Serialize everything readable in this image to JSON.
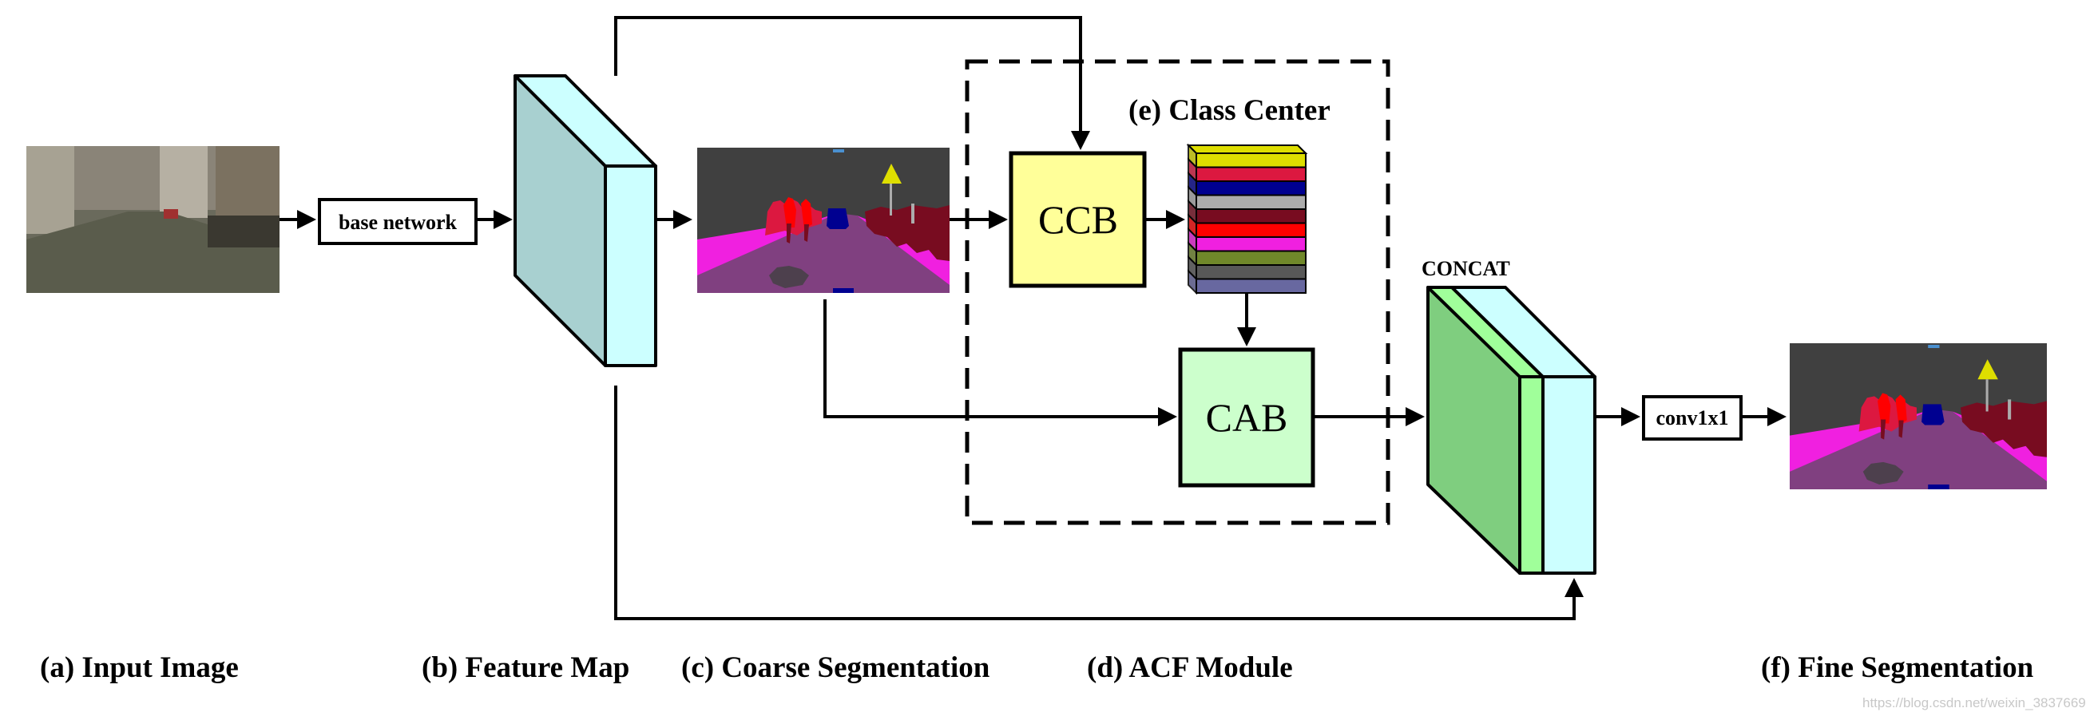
{
  "blocks": {
    "base_network": "base network",
    "ccb": "CCB",
    "cab": "CAB",
    "concat": "CONCAT",
    "conv": "conv1x1",
    "class_center": "(e) Class Center"
  },
  "captions": {
    "a": "(a) Input Image",
    "b": "(b) Feature Map",
    "c": "(c) Coarse Segmentation",
    "d": "(d) ACF Module",
    "f": "(f) Fine Segmentation"
  },
  "watermark": "https://blog.csdn.net/weixin_38376693",
  "colors": {
    "ccb_fill": "#ffff99",
    "cab_fill": "#ccffcc",
    "feature_front": "#ccffff",
    "feature_side": "#a8d0d0",
    "concat_green": "#7fce7f",
    "concat_light_green": "#a0ff9a",
    "class_center_bands": [
      "#dede00",
      "#dc1840",
      "#000090",
      "#acacac",
      "#780c20",
      "#ff0000",
      "#f020e0",
      "#70882a",
      "#585858",
      "#6868a0"
    ]
  }
}
